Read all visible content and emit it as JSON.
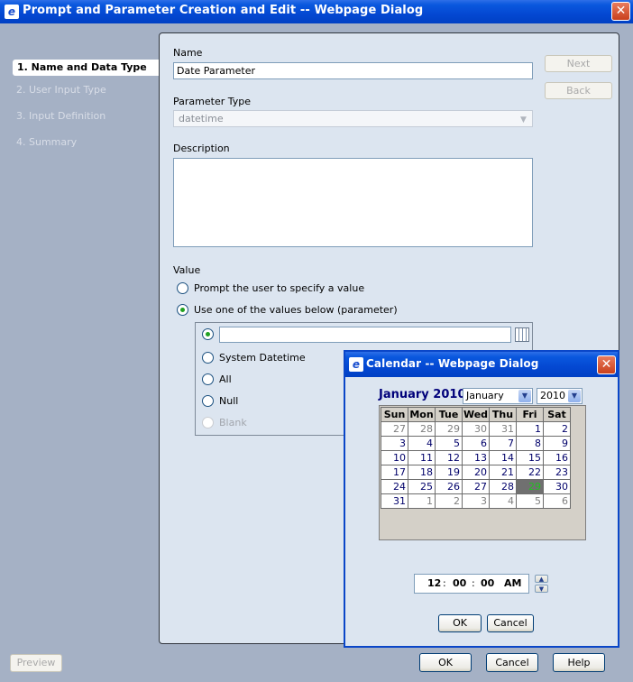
{
  "window": {
    "title": "Prompt and Parameter Creation and Edit -- Webpage Dialog",
    "icon": "ie-icon"
  },
  "steps": [
    {
      "label": "1. Name and Data Type",
      "active": true
    },
    {
      "label": "2. User Input Type",
      "active": false
    },
    {
      "label": "3. Input Definition",
      "active": false
    },
    {
      "label": "4. Summary",
      "active": false
    }
  ],
  "form": {
    "name_label": "Name",
    "name_value": "Date Parameter",
    "param_type_label": "Parameter Type",
    "param_type_value": "datetime",
    "description_label": "Description",
    "description_value": "",
    "value_label": "Value",
    "radio_prompt": "Prompt the user to specify a value",
    "radio_use": "Use one of the values below (parameter)",
    "opt_custom_value": "",
    "opt_system_datetime": "System Datetime",
    "opt_all": "All",
    "opt_null": "Null",
    "opt_blank": "Blank"
  },
  "side_buttons": {
    "next": "Next",
    "back": "Back"
  },
  "bottom_buttons": {
    "preview": "Preview",
    "ok": "OK",
    "cancel": "Cancel",
    "help": "Help"
  },
  "calendar": {
    "title": "Calendar -- Webpage Dialog",
    "heading": "January 2010",
    "month_value": "January",
    "year_value": "2010",
    "days": [
      "Sun",
      "Mon",
      "Tue",
      "Wed",
      "Thu",
      "Fri",
      "Sat"
    ],
    "weeks": [
      [
        "27",
        "28",
        "29",
        "30",
        "31",
        "1",
        "2"
      ],
      [
        "3",
        "4",
        "5",
        "6",
        "7",
        "8",
        "9"
      ],
      [
        "10",
        "11",
        "12",
        "13",
        "14",
        "15",
        "16"
      ],
      [
        "17",
        "18",
        "19",
        "20",
        "21",
        "22",
        "23"
      ],
      [
        "24",
        "25",
        "26",
        "27",
        "28",
        "29",
        "30"
      ],
      [
        "31",
        "1",
        "2",
        "3",
        "4",
        "5",
        "6"
      ]
    ],
    "selected_day": "29",
    "time": {
      "hour": "12",
      "minute": "00",
      "second": "00",
      "ampm": "AM"
    },
    "ok": "OK",
    "cancel": "Cancel"
  },
  "colors": {
    "title_bar": "#0448d2",
    "panel_bg": "#dce5f0",
    "selected_day_bg": "#707070",
    "selected_day_text": "#21c021"
  }
}
